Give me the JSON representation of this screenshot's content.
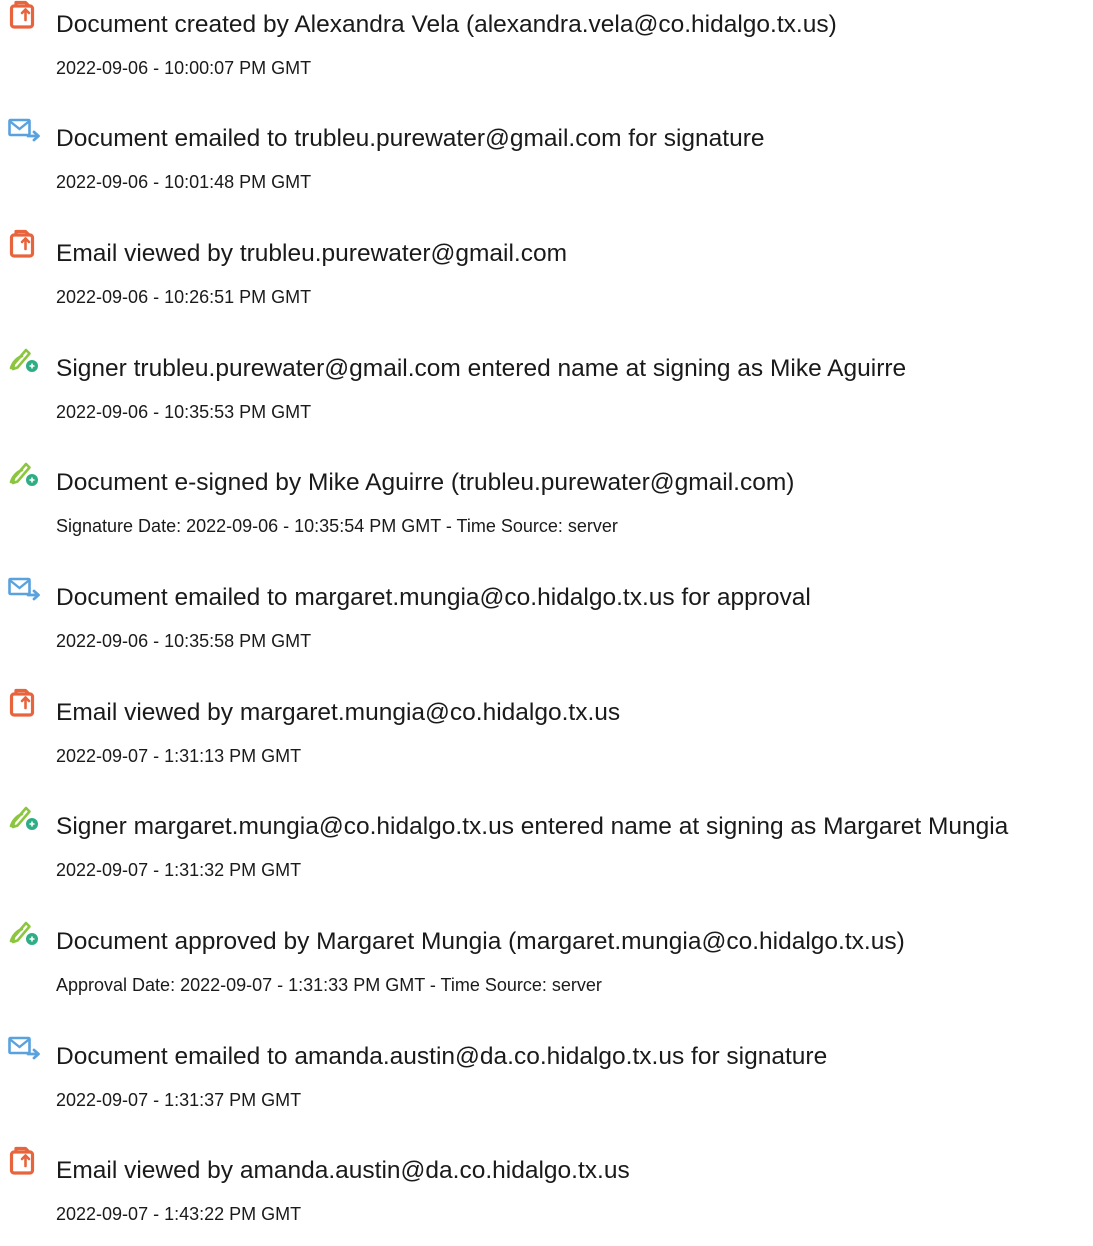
{
  "events": [
    {
      "icon": "document-icon",
      "title": "Document created by Alexandra Vela (alexandra.vela@co.hidalgo.tx.us)",
      "subtitle": "2022-09-06 - 10:00:07 PM GMT"
    },
    {
      "icon": "email-send-icon",
      "title": "Document emailed to trubleu.purewater@gmail.com for signature",
      "subtitle": "2022-09-06 - 10:01:48 PM GMT"
    },
    {
      "icon": "document-icon",
      "title": "Email viewed by trubleu.purewater@gmail.com",
      "subtitle": "2022-09-06 - 10:26:51 PM GMT"
    },
    {
      "icon": "pen-sign-icon",
      "title": "Signer trubleu.purewater@gmail.com entered name at signing as Mike Aguirre",
      "subtitle": "2022-09-06 - 10:35:53 PM GMT"
    },
    {
      "icon": "pen-sign-icon",
      "title": "Document e-signed by Mike Aguirre (trubleu.purewater@gmail.com)",
      "subtitle": "Signature Date: 2022-09-06 - 10:35:54 PM GMT - Time Source: server"
    },
    {
      "icon": "email-send-icon",
      "title": "Document emailed to margaret.mungia@co.hidalgo.tx.us for approval",
      "subtitle": "2022-09-06 - 10:35:58 PM GMT"
    },
    {
      "icon": "document-icon",
      "title": "Email viewed by margaret.mungia@co.hidalgo.tx.us",
      "subtitle": "2022-09-07 - 1:31:13 PM GMT"
    },
    {
      "icon": "pen-sign-icon",
      "title": "Signer margaret.mungia@co.hidalgo.tx.us entered name at signing as Margaret Mungia",
      "subtitle": "2022-09-07 - 1:31:32 PM GMT"
    },
    {
      "icon": "pen-sign-icon",
      "title": "Document approved by Margaret Mungia (margaret.mungia@co.hidalgo.tx.us)",
      "subtitle": "Approval Date: 2022-09-07 - 1:31:33 PM GMT - Time Source: server"
    },
    {
      "icon": "email-send-icon",
      "title": "Document emailed to amanda.austin@da.co.hidalgo.tx.us for signature",
      "subtitle": "2022-09-07 - 1:31:37 PM GMT"
    },
    {
      "icon": "document-icon",
      "title": "Email viewed by amanda.austin@da.co.hidalgo.tx.us",
      "subtitle": "2022-09-07 - 1:43:22 PM GMT"
    }
  ],
  "colors": {
    "document_icon": "#e8643c",
    "email_icon": "#5aa2de",
    "pen_icon": "#8cc63f",
    "pen_badge": "#2fae86"
  }
}
